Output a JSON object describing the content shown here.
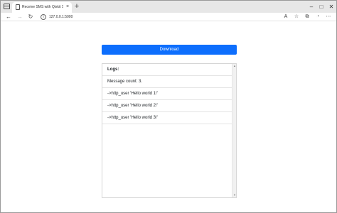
{
  "browser": {
    "tab_title": "Receive SMS with Qiskit SMS Gateway",
    "tab_close": "×",
    "new_tab": "+",
    "url": "127.0.0.1:5000",
    "controls": {
      "minimize": "–",
      "maximize": "□",
      "close": "✕"
    }
  },
  "page": {
    "download_label": "Download",
    "logs": {
      "header": "Logs:",
      "rows": [
        "Message count: 3.",
        "->http_user 'Hello world 1!'",
        "->http_user 'Hello world 2!'",
        "->http_user 'Hello world 3!'"
      ]
    }
  },
  "colors": {
    "accent": "#0d6efd",
    "tabstrip": "#e7e7e7"
  }
}
